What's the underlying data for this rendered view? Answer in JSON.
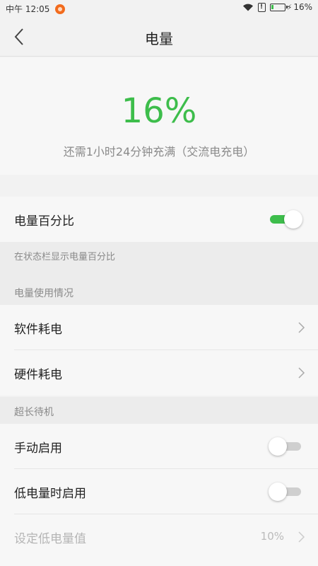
{
  "status_bar": {
    "time": "中午 12:05",
    "battery_percent": "16%",
    "battery_level": 0.16,
    "sim_glyph": "!"
  },
  "header": {
    "title": "电量",
    "back_icon": "chevron-left-icon"
  },
  "battery": {
    "percent": "16%",
    "charge_info": "还需1小时24分钟充满（交流电充电）",
    "accent_color": "#3dbd4b"
  },
  "settings": {
    "battery_percentage": {
      "label": "电量百分比",
      "enabled": true
    },
    "battery_percentage_desc": "在状态栏显示电量百分比",
    "usage_section": "电量使用情况",
    "software_usage": "软件耗电",
    "hardware_usage": "硬件耗电",
    "standby_section": "超长待机",
    "manual_enable": {
      "label": "手动启用",
      "enabled": false
    },
    "low_battery_enable": {
      "label": "低电量时启用",
      "enabled": false
    },
    "low_battery_value": {
      "label": "设定低电量值",
      "value": "10%"
    }
  }
}
